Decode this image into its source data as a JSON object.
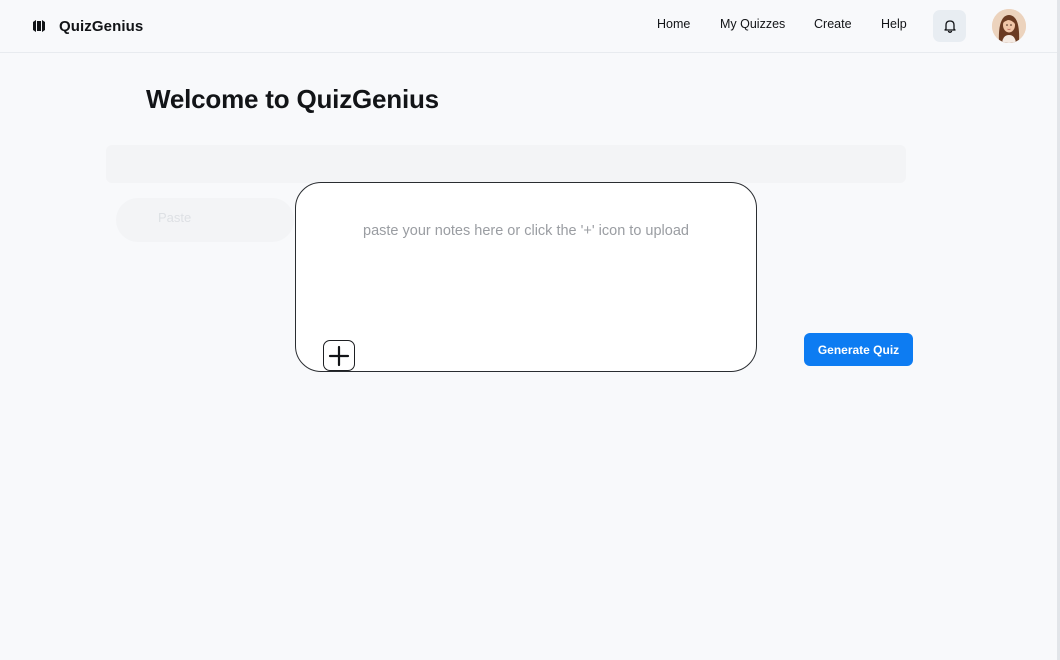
{
  "app": {
    "name": "QuizGenius"
  },
  "nav": {
    "items": [
      {
        "label": "Home"
      },
      {
        "label": "My Quizzes"
      },
      {
        "label": "Create"
      },
      {
        "label": "Help"
      }
    ]
  },
  "header": {
    "icons": [
      "logo-icon",
      "bell-icon",
      "user-avatar"
    ]
  },
  "main": {
    "title": "Welcome to QuizGenius",
    "notes_placeholder": "paste your notes here or click the '+' icon to upload",
    "notes_value": "",
    "upload_icon": "plus-icon",
    "generate_label": "Generate Quiz",
    "background_fragment": "Paste"
  },
  "colors": {
    "primary": "#0d7cf2",
    "background": "#f8f9fb",
    "bell_background": "#e8edf2",
    "text": "#121417"
  }
}
